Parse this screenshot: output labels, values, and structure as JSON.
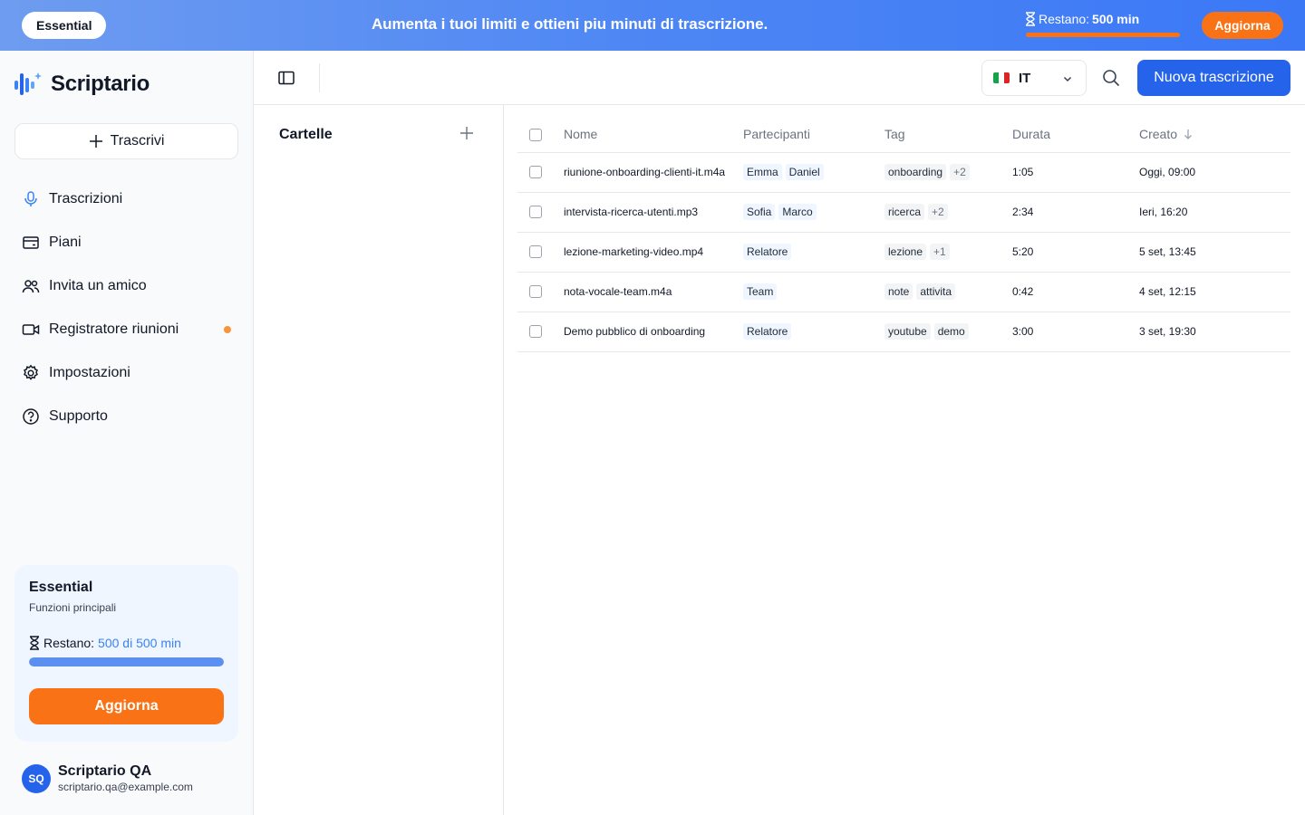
{
  "banner": {
    "plan": "Essential",
    "message": "Aumenta i tuoi limiti e ottieni piu minuti di trascrizione.",
    "remaining_label": "Restano:",
    "remaining_value": "500 min",
    "remaining_fraction": 1.0,
    "upgrade_label": "Aggiorna"
  },
  "brand": {
    "name": "Scriptario",
    "color": "#2563eb"
  },
  "sidebar": {
    "transcribe_label": "Trascrivi",
    "items": [
      {
        "label": "Trascrizioni",
        "icon": "microphone-icon",
        "active": true
      },
      {
        "label": "Piani",
        "icon": "credit-card-icon"
      },
      {
        "label": "Invita un amico",
        "icon": "users-icon"
      },
      {
        "label": "Registratore riunioni",
        "icon": "video-camera-icon",
        "badge": true
      },
      {
        "label": "Impostazioni",
        "icon": "gear-icon"
      },
      {
        "label": "Supporto",
        "icon": "help-circle-icon"
      }
    ],
    "plan_card": {
      "title": "Essential",
      "subtitle": "Funzioni principali",
      "remaining_label": "Restano:",
      "remaining_value": "500 di 500 min",
      "remaining_fraction": 1.0,
      "upgrade_label": "Aggiorna"
    },
    "user": {
      "initials": "SQ",
      "name": "Scriptario QA",
      "email": "scriptario.qa@example.com"
    }
  },
  "header": {
    "language": "IT",
    "new_button_label": "Nuova trascrizione"
  },
  "folders": {
    "title": "Cartelle"
  },
  "table": {
    "columns": [
      "Nome",
      "Partecipanti",
      "Tag",
      "Durata",
      "Creato"
    ],
    "sort_column": "Creato",
    "rows": [
      {
        "name": "riunione-onboarding-clienti-it.m4a",
        "participants": [
          "Emma",
          "Daniel"
        ],
        "tags": [
          "onboarding"
        ],
        "more_tags": "+2",
        "duration": "1:05",
        "created": "Oggi, 09:00"
      },
      {
        "name": "intervista-ricerca-utenti.mp3",
        "participants": [
          "Sofia",
          "Marco"
        ],
        "tags": [
          "ricerca"
        ],
        "more_tags": "+2",
        "duration": "2:34",
        "created": "Ieri, 16:20"
      },
      {
        "name": "lezione-marketing-video.mp4",
        "participants": [
          "Relatore"
        ],
        "tags": [
          "lezione"
        ],
        "more_tags": "+1",
        "duration": "5:20",
        "created": "5 set, 13:45"
      },
      {
        "name": "nota-vocale-team.m4a",
        "participants": [
          "Team"
        ],
        "tags": [
          "note",
          "attivita"
        ],
        "more_tags": "",
        "duration": "0:42",
        "created": "4 set, 12:15"
      },
      {
        "name": "Demo pubblico di onboarding",
        "participants": [
          "Relatore"
        ],
        "tags": [
          "youtube",
          "demo"
        ],
        "more_tags": "",
        "duration": "3:00",
        "created": "3 set, 19:30"
      }
    ]
  },
  "colors": {
    "accent": "#2563eb",
    "upgrade": "#f97316"
  }
}
